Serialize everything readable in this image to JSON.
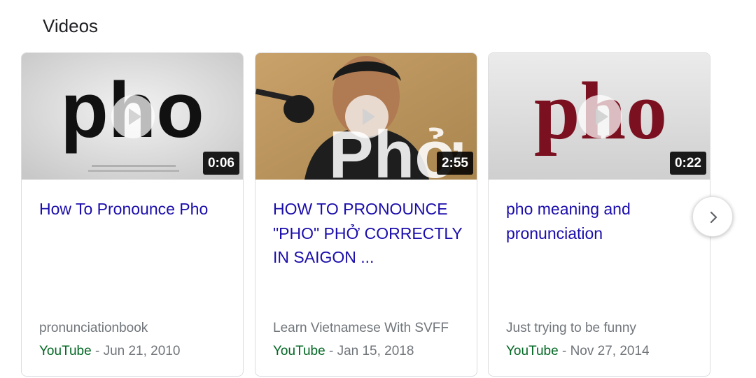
{
  "section": {
    "title": "Videos"
  },
  "videos": [
    {
      "thumb_text": "pho",
      "duration": "0:06",
      "title": "How To Pronounce Pho",
      "channel": "pronunciationbook",
      "source": "YouTube",
      "separator": " - ",
      "date": "Jun 21, 2010"
    },
    {
      "thumb_text": "Phở",
      "duration": "2:55",
      "title": "HOW TO PRONOUNCE \"PHO\" PHỞ CORRECTLY IN SAIGON ...",
      "channel": "Learn Vietnamese With SVFF",
      "source": "YouTube",
      "separator": " - ",
      "date": "Jan 15, 2018"
    },
    {
      "thumb_text": "pho",
      "duration": "0:22",
      "title": "pho meaning and pronunciation",
      "channel": "Just trying to be funny",
      "source": "YouTube",
      "separator": " - ",
      "date": "Nov 27, 2014"
    }
  ],
  "icons": {
    "play": "play-icon",
    "next": "chevron-right-icon"
  },
  "colors": {
    "title_link": "#1a0dab",
    "source_green": "#006621",
    "meta_gray": "#70757a",
    "thumb3_text": "#7b1020"
  }
}
